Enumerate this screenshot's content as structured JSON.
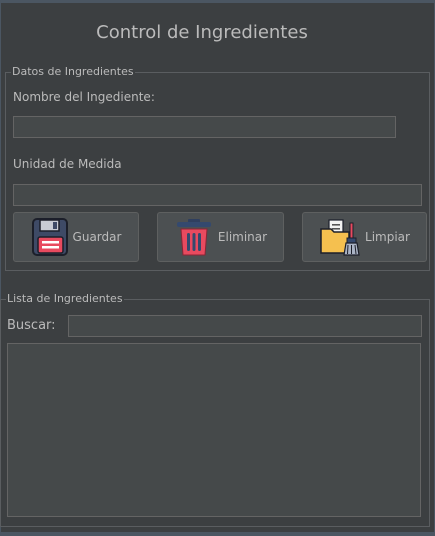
{
  "window": {
    "title": "Control de Ingredientes"
  },
  "datos": {
    "legend": "Datos de Ingredientes",
    "nombre_label": "Nombre del Ingediente:",
    "nombre_value": "",
    "unidad_label": "Unidad de Medida",
    "unidad_value": ""
  },
  "buttons": {
    "guardar": "Guardar",
    "eliminar": "Eliminar",
    "limpiar": "Limpiar"
  },
  "icons": {
    "guardar": "floppy-disk-icon",
    "eliminar": "trash-can-icon",
    "limpiar": "folder-broom-icon"
  },
  "lista": {
    "legend": "Lista de Ingredientes",
    "buscar_label": "Buscar:",
    "buscar_value": "",
    "items": []
  },
  "colors": {
    "background": "#3c3f41",
    "field": "#45494a",
    "button": "#4c5052",
    "text": "#bbbbbb"
  }
}
